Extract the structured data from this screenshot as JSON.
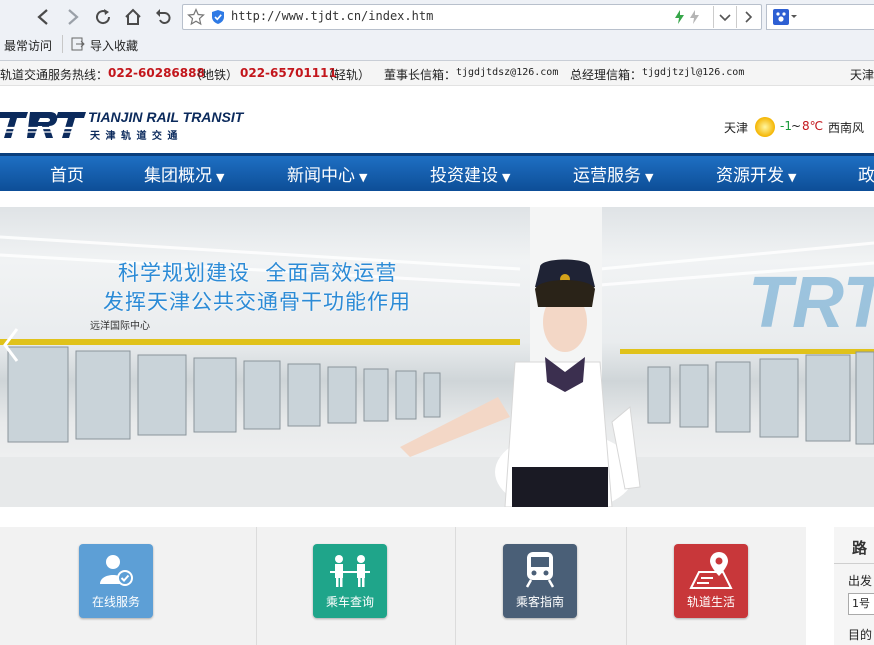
{
  "browser": {
    "url": "http://www.tjdt.cn/index.htm",
    "bookmarks": [
      "最常访问",
      "导入收藏"
    ],
    "icons": [
      "back-icon",
      "forward-icon",
      "refresh-icon",
      "home-icon",
      "undo-icon",
      "star-icon",
      "shield-icon",
      "lightning-icon",
      "chevron-down-icon",
      "chevron-right-icon",
      "paw-icon"
    ]
  },
  "infobar": {
    "hotline_prefix": "轨道交通服务热线：",
    "metro_phone": "022-60286888",
    "metro_label": "（地铁）",
    "light_phone": "022-65701111",
    "light_label": "（轻轨）",
    "chairman_label": "董事长信箱：",
    "chairman_email": "tjgdjtdsz@126.com",
    "gm_label": "总经理信箱：",
    "gm_email": "tjgdjtzjl@126.com",
    "right_text": "天津"
  },
  "header": {
    "logo_mark": "TRT",
    "logo_en": "TIANJIN RAIL TRANSIT",
    "logo_cn": "天 津 轨 道 交 通",
    "weather_city": "天津",
    "weather_temp_low": "-1",
    "weather_sep": "~",
    "weather_temp_high": "8℃",
    "weather_wind": "西南风"
  },
  "nav": {
    "items": [
      {
        "label": "首页",
        "has_menu": false
      },
      {
        "label": "集团概况",
        "has_menu": true
      },
      {
        "label": "新闻中心",
        "has_menu": true
      },
      {
        "label": "投资建设",
        "has_menu": true
      },
      {
        "label": "运营服务",
        "has_menu": true
      },
      {
        "label": "资源开发",
        "has_menu": true
      },
      {
        "label": "政",
        "has_menu": false
      }
    ]
  },
  "banner": {
    "line1": "科学规划建设  全面高效运营",
    "line2": "发挥天津公共交通骨干功能作用",
    "station_sign": "远洋国际中心",
    "watermark": "TRT"
  },
  "services": [
    {
      "label": "在线服务",
      "color": "#5d9fd6",
      "icon": "user-check-icon"
    },
    {
      "label": "乘车查询",
      "color": "#1fa58a",
      "icon": "passengers-icon"
    },
    {
      "label": "乘客指南",
      "color": "#4a5f77",
      "icon": "train-icon"
    },
    {
      "label": "轨道生活",
      "color": "#c8373a",
      "icon": "map-pin-icon"
    }
  ],
  "right_panel": {
    "title": "路",
    "from_label": "出发",
    "select_value": "1号",
    "to_label": "目的"
  },
  "colors": {
    "nav_blue": "#0d4e97",
    "hotline_red": "#c3161c",
    "logo_navy": "#0b2a5c"
  }
}
